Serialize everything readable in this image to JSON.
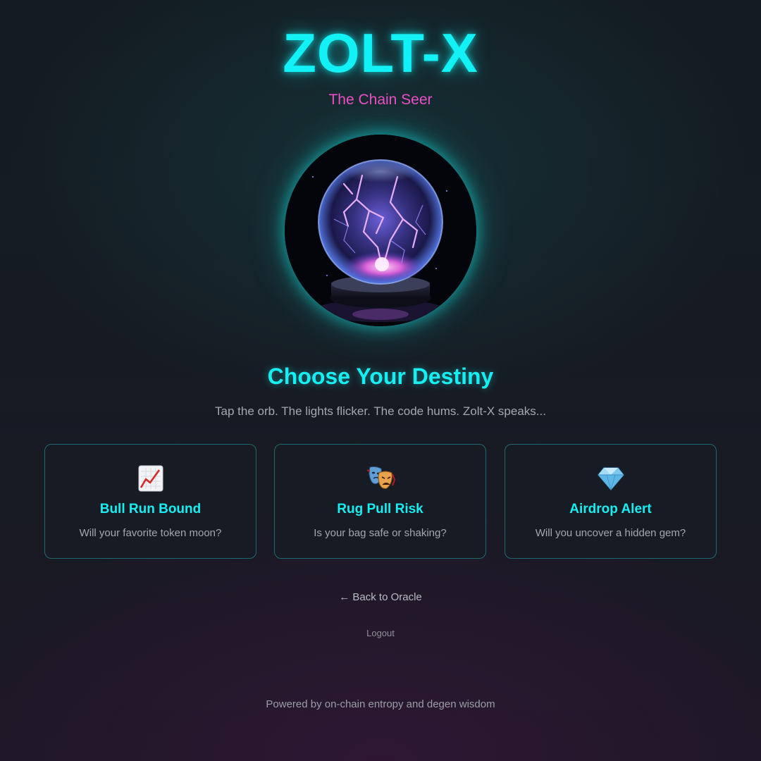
{
  "header": {
    "title": "ZOLT-X",
    "subtitle": "The Chain Seer"
  },
  "orb": {
    "icon": "crystal-ball-lightning-image",
    "glow_color": "#12f2f6"
  },
  "main": {
    "heading": "Choose Your Destiny",
    "tagline": "Tap the orb. The lights flicker. The code hums. Zolt-X speaks..."
  },
  "cards": [
    {
      "icon": "chart-increasing-icon",
      "title": "Bull Run Bound",
      "description": "Will your favorite token moon?"
    },
    {
      "icon": "performing-arts-icon",
      "title": "Rug Pull Risk",
      "description": "Is your bag safe or shaking?"
    },
    {
      "icon": "gem-icon",
      "title": "Airdrop Alert",
      "description": "Will you uncover a hidden gem?"
    }
  ],
  "nav": {
    "back_label": "← Back to Oracle",
    "logout_label": "Logout"
  },
  "footer": {
    "text": "Powered by on-chain entropy and degen wisdom"
  },
  "colors": {
    "accent_cyan": "#16eef2",
    "accent_pink": "#ec4fc8",
    "card_border": "#1f6a70"
  }
}
